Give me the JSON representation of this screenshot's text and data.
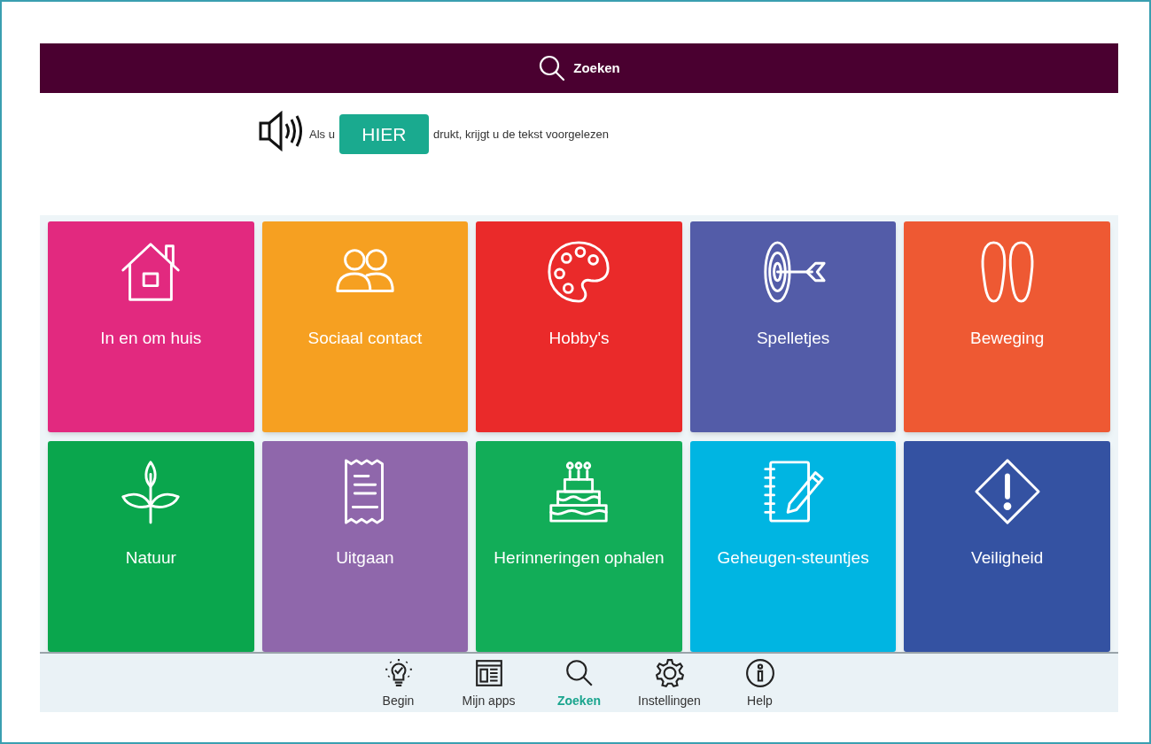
{
  "header": {
    "title": "Zoeken"
  },
  "intro": {
    "before": "Als u",
    "button": "HIER",
    "after": "drukt, krijgt u de tekst voorgelezen"
  },
  "tiles": [
    {
      "label": "In en om huis",
      "color": "#e2297f"
    },
    {
      "label": "Sociaal contact",
      "color": "#f6a021"
    },
    {
      "label": "Hobby's",
      "color": "#ea2a2a"
    },
    {
      "label": "Spelletjes",
      "color": "#535ca8"
    },
    {
      "label": "Beweging",
      "color": "#ee5933"
    },
    {
      "label": "Natuur",
      "color": "#0aa64d"
    },
    {
      "label": "Uitgaan",
      "color": "#8f67ab"
    },
    {
      "label": "Herinneringen ophalen",
      "color": "#12ad58"
    },
    {
      "label": "Geheugen-steuntjes",
      "color": "#00b5e2"
    },
    {
      "label": "Veiligheid",
      "color": "#3452a2"
    }
  ],
  "nav": [
    {
      "label": "Begin",
      "selected": false
    },
    {
      "label": "Mijn apps",
      "selected": false
    },
    {
      "label": "Zoeken",
      "selected": true
    },
    {
      "label": "Instellingen",
      "selected": false
    },
    {
      "label": "Help",
      "selected": false
    }
  ]
}
